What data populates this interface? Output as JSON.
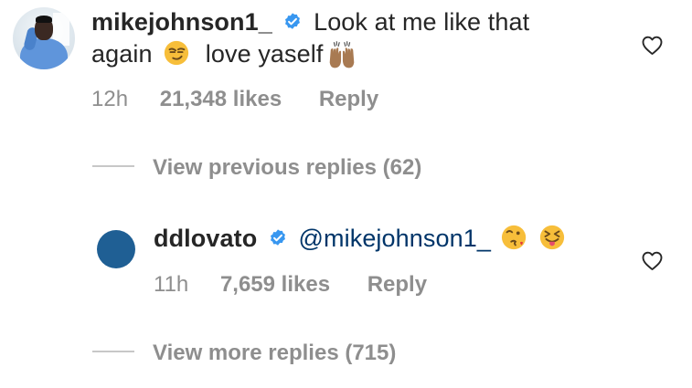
{
  "comments": [
    {
      "username": "mikejohnson1_",
      "text_part1": "Look at me like that",
      "text_part2": "again",
      "text_part3": "love yaself",
      "emojis": [
        "smirking-face-emoji",
        "raised-hands-emoji"
      ],
      "time": "12h",
      "likes": "21,348 likes",
      "reply_label": "Reply"
    },
    {
      "username": "ddlovato",
      "mention": "@mikejohnson1_",
      "emojis": [
        "face-throwing-kiss-emoji",
        "squinting-face-with-tongue-emoji"
      ],
      "time": "11h",
      "likes": "7,659 likes",
      "reply_label": "Reply"
    }
  ],
  "view_previous_replies": "View previous replies (62)",
  "view_more_replies": "View more replies (715)",
  "colors": {
    "text": "#262626",
    "meta": "#8e8e8e",
    "verified": "#3897f0",
    "mention": "#003569",
    "avatar_blue": "#1f5f94"
  }
}
